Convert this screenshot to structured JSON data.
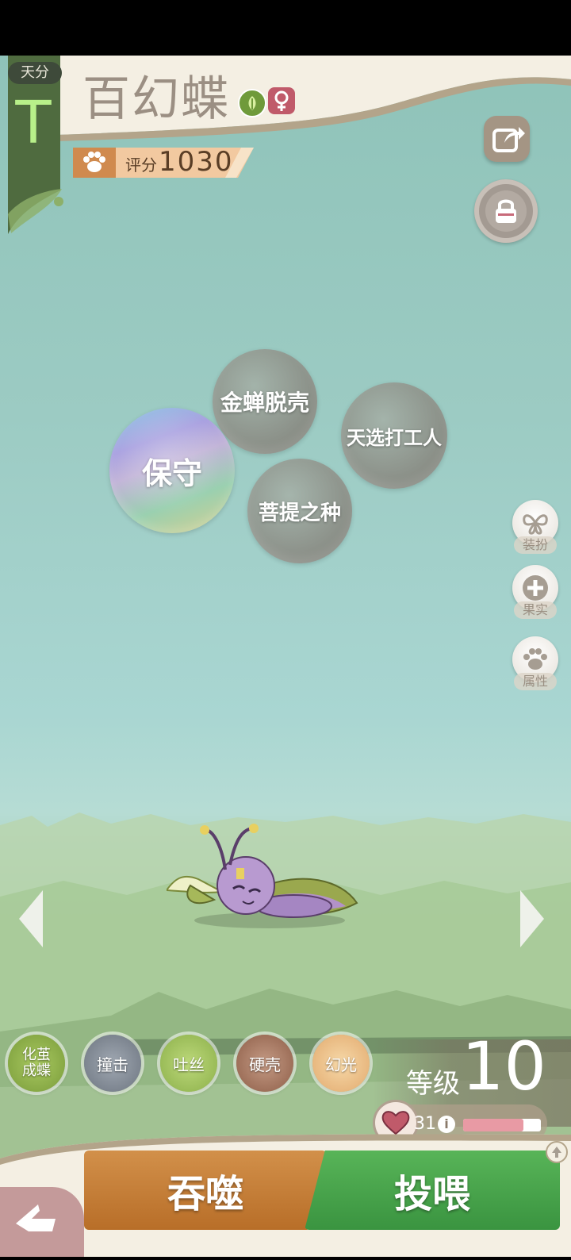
{
  "header": {
    "tier_label": "天分",
    "tier_grade": "T",
    "pet_name": "百幻蝶",
    "element_icon": "grass-leaf-icon",
    "gender_icon": "female-icon",
    "score_label": "评分",
    "score_value": "1030"
  },
  "top_buttons": {
    "share_icon": "share-icon",
    "lock_icon": "lock-icon"
  },
  "traits": [
    {
      "label": "金蝉脱壳",
      "style": "plain"
    },
    {
      "label": "天选打工人",
      "style": "plain"
    },
    {
      "label": "保守",
      "style": "rainbow"
    },
    {
      "label": "菩提之种",
      "style": "plain"
    }
  ],
  "side_menu": [
    {
      "label": "装扮",
      "icon": "butterfly-icon"
    },
    {
      "label": "果实",
      "icon": "plus-icon"
    },
    {
      "label": "属性",
      "icon": "paw-icon"
    }
  ],
  "skills": [
    {
      "label": "化茧\n成蝶",
      "color": "#8fb04a"
    },
    {
      "label": "撞击",
      "color": "#7d8590"
    },
    {
      "label": "吐丝",
      "color": "#9cbc54"
    },
    {
      "label": "硬壳",
      "color": "#9a6a52"
    },
    {
      "label": "幻光",
      "color": "#e0b07a"
    }
  ],
  "level": {
    "label": "等级",
    "value": "10"
  },
  "affection": {
    "value": "31",
    "info_icon": "info-icon",
    "heart_icon": "heart-icon",
    "progress": 0.78
  },
  "actions": {
    "devour_label": "吞噬",
    "feed_label": "投喂",
    "devour_color": "#c8843a",
    "feed_color": "#4aa24a"
  },
  "nav": {
    "prev_icon": "chevron-left-icon",
    "next_icon": "chevron-right-icon",
    "back_icon": "back-icon"
  }
}
